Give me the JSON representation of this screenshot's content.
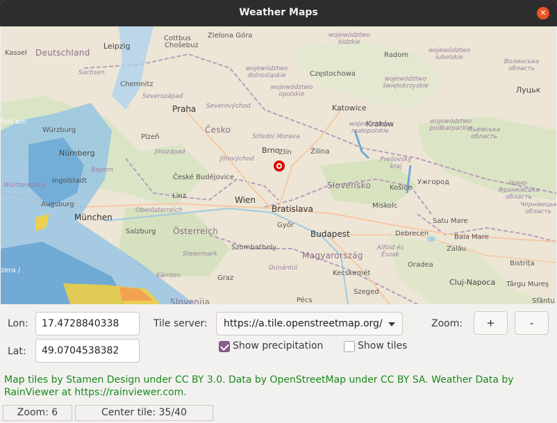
{
  "window": {
    "title": "Weather Maps",
    "close_icon": "close-icon"
  },
  "map": {
    "cities": [
      {
        "name": "Kassel"
      },
      {
        "name": "Deutschland"
      },
      {
        "name": "Leipzig"
      },
      {
        "name": "Chemnitz"
      },
      {
        "name": "Zielona Góra"
      },
      {
        "name": "Cottbus"
      },
      {
        "name": "Chošebuz"
      },
      {
        "name": "Praha"
      },
      {
        "name": "Česko"
      },
      {
        "name": "Plzeň"
      },
      {
        "name": "České Budějovice"
      },
      {
        "name": "Linz"
      },
      {
        "name": "München"
      },
      {
        "name": "Nürnberg"
      },
      {
        "name": "Würzburg"
      },
      {
        "name": "Augsburg"
      },
      {
        "name": "Ingolstadt"
      },
      {
        "name": "Salzburg"
      },
      {
        "name": "Österreich"
      },
      {
        "name": "Wien"
      },
      {
        "name": "Bratislava"
      },
      {
        "name": "Brno"
      },
      {
        "name": "Zlín"
      },
      {
        "name": "Žilina"
      },
      {
        "name": "Katowice"
      },
      {
        "name": "Częstochowa"
      },
      {
        "name": "Kraków"
      },
      {
        "name": "Radom"
      },
      {
        "name": "Slovensko"
      },
      {
        "name": "Košice"
      },
      {
        "name": "Ужгород"
      },
      {
        "name": "Miskolc"
      },
      {
        "name": "Budapest"
      },
      {
        "name": "Magyarország"
      },
      {
        "name": "Győr"
      },
      {
        "name": "Szombathely"
      },
      {
        "name": "Debrecen"
      },
      {
        "name": "Oradea"
      },
      {
        "name": "Cluj-Napoca"
      },
      {
        "name": "Satu Mare"
      },
      {
        "name": "Baia Mare"
      },
      {
        "name": "Zalău"
      },
      {
        "name": "Bistrița"
      },
      {
        "name": "Târgu Mureș"
      },
      {
        "name": "Szeged"
      },
      {
        "name": "Kecskemét"
      },
      {
        "name": "Pécs"
      },
      {
        "name": "Graz"
      },
      {
        "name": "Луцьк"
      },
      {
        "name": "Slovenija"
      },
      {
        "name": "Sfântu"
      }
    ],
    "regions": [
      {
        "name": "województwo łódzkie"
      },
      {
        "name": "województwo lubelskie"
      },
      {
        "name": "województwo dolnośląskie"
      },
      {
        "name": "województwo opolskie"
      },
      {
        "name": "województwo świętokrzyskie"
      },
      {
        "name": "województwo małopolskie"
      },
      {
        "name": "województwo podkarpackie"
      },
      {
        "name": "Волинська область"
      },
      {
        "name": "Львівська область"
      },
      {
        "name": "Severozápad"
      },
      {
        "name": "Severovýchod"
      },
      {
        "name": "Jihozápad"
      },
      {
        "name": "Jihovýchod"
      },
      {
        "name": "Střední Morava"
      },
      {
        "name": "Prešovský kraj"
      },
      {
        "name": "Oberösterreich"
      },
      {
        "name": "Steiermark"
      },
      {
        "name": "Kärnten"
      },
      {
        "name": "Dunántúl"
      },
      {
        "name": "Alföld és Észak"
      },
      {
        "name": "Івано-Франківська область"
      },
      {
        "name": "Чернівецька область"
      },
      {
        "name": "Bayern"
      },
      {
        "name": "Württemberg"
      },
      {
        "name": "Sachsen"
      },
      {
        "name": "furt am"
      },
      {
        "name": "zera /"
      }
    ],
    "marker": {
      "lon": "17.4728840338",
      "lat": "49.0704538382"
    }
  },
  "controls": {
    "lon_label": "Lon:",
    "lon_value": "17.4728840338",
    "lat_label": "Lat:",
    "lat_value": "49.0704538382",
    "tile_server_label": "Tile server:",
    "tile_server_value": "https://a.tile.openstreetmap.org/",
    "zoom_label": "Zoom:",
    "zoom_in": "+",
    "zoom_out": "-",
    "show_precipitation": "Show precipitation",
    "show_precipitation_checked": true,
    "show_tiles": "Show tiles",
    "show_tiles_checked": false
  },
  "credits": "Map tiles by Stamen Design under CC BY 3.0. Data by OpenStreetMap under CC BY SA. Weather Data by RainViewer at https://rainviewer.com.",
  "status": {
    "zoom": "Zoom: 6",
    "center_tile": "Center tile: 35/40"
  },
  "colors": {
    "accent": "#8b5c8f",
    "credits": "#1a8a1a",
    "marker": "#e00000",
    "titlebar": "#2d2d2d",
    "close": "#e95420"
  }
}
